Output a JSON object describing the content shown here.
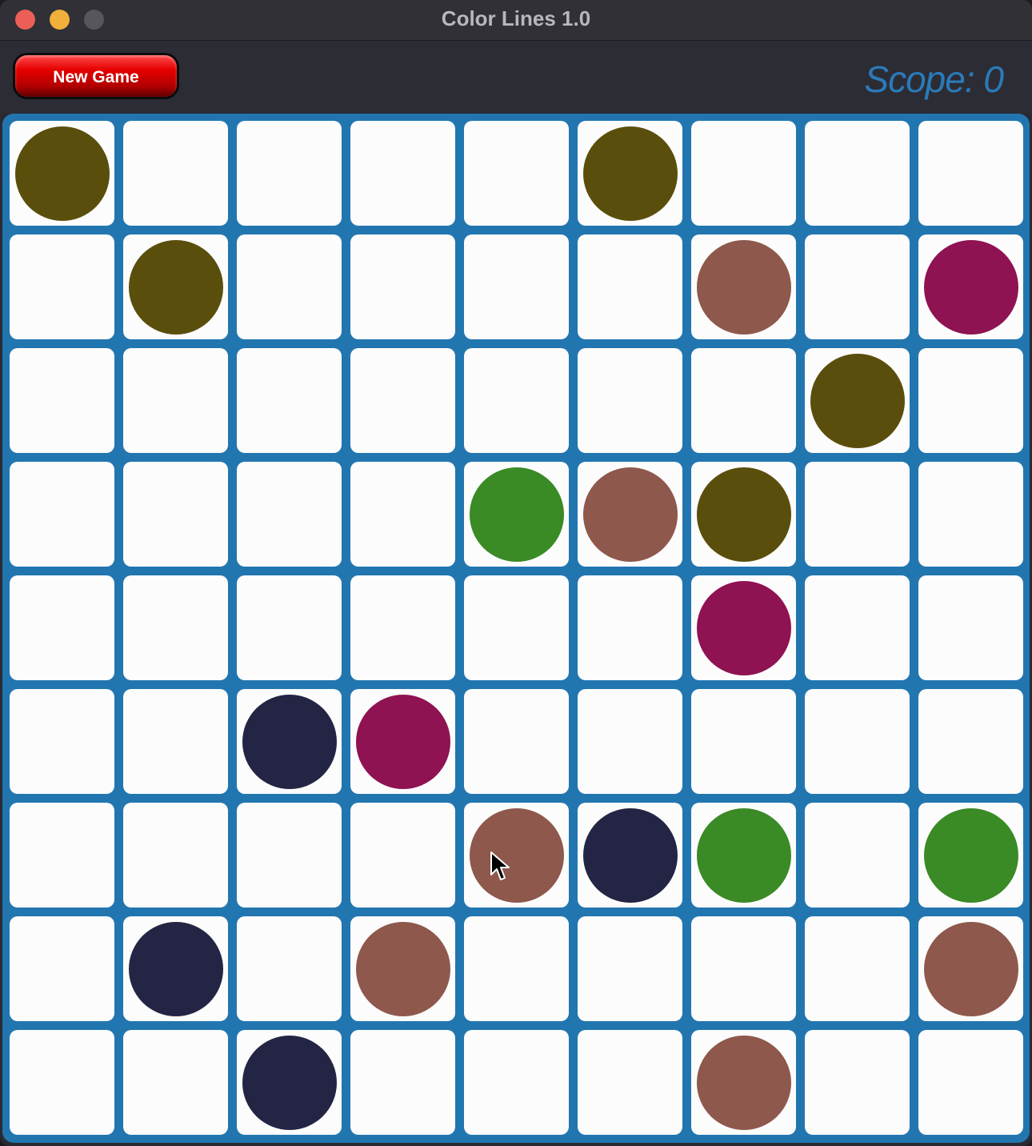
{
  "window": {
    "title": "Color Lines 1.0"
  },
  "toolbar": {
    "new_game_label": "New Game",
    "score_text": "Scope: 0"
  },
  "colors": {
    "olive": "#5a4e0c",
    "rose": "#8e584c",
    "magenta": "#8f1252",
    "green": "#3a8a26",
    "navy": "#242444",
    "board_border": "#2276b0",
    "cell": "#fcfcfc"
  },
  "board": {
    "rows": 9,
    "cols": 9,
    "grid": [
      [
        "olive",
        null,
        null,
        null,
        null,
        "olive",
        null,
        null,
        null
      ],
      [
        null,
        "olive",
        null,
        null,
        null,
        null,
        "rose",
        null,
        "magenta"
      ],
      [
        null,
        null,
        null,
        null,
        null,
        null,
        null,
        "olive",
        null
      ],
      [
        null,
        null,
        null,
        null,
        "green",
        "rose",
        "olive",
        null,
        null
      ],
      [
        null,
        null,
        null,
        null,
        null,
        null,
        "magenta",
        null,
        null
      ],
      [
        null,
        null,
        "navy",
        "magenta",
        null,
        null,
        null,
        null,
        null
      ],
      [
        null,
        null,
        null,
        null,
        "rose",
        "navy",
        "green",
        null,
        "green"
      ],
      [
        null,
        "navy",
        null,
        "rose",
        null,
        null,
        null,
        null,
        "rose"
      ],
      [
        null,
        null,
        "navy",
        null,
        null,
        null,
        "rose",
        null,
        null
      ]
    ]
  }
}
